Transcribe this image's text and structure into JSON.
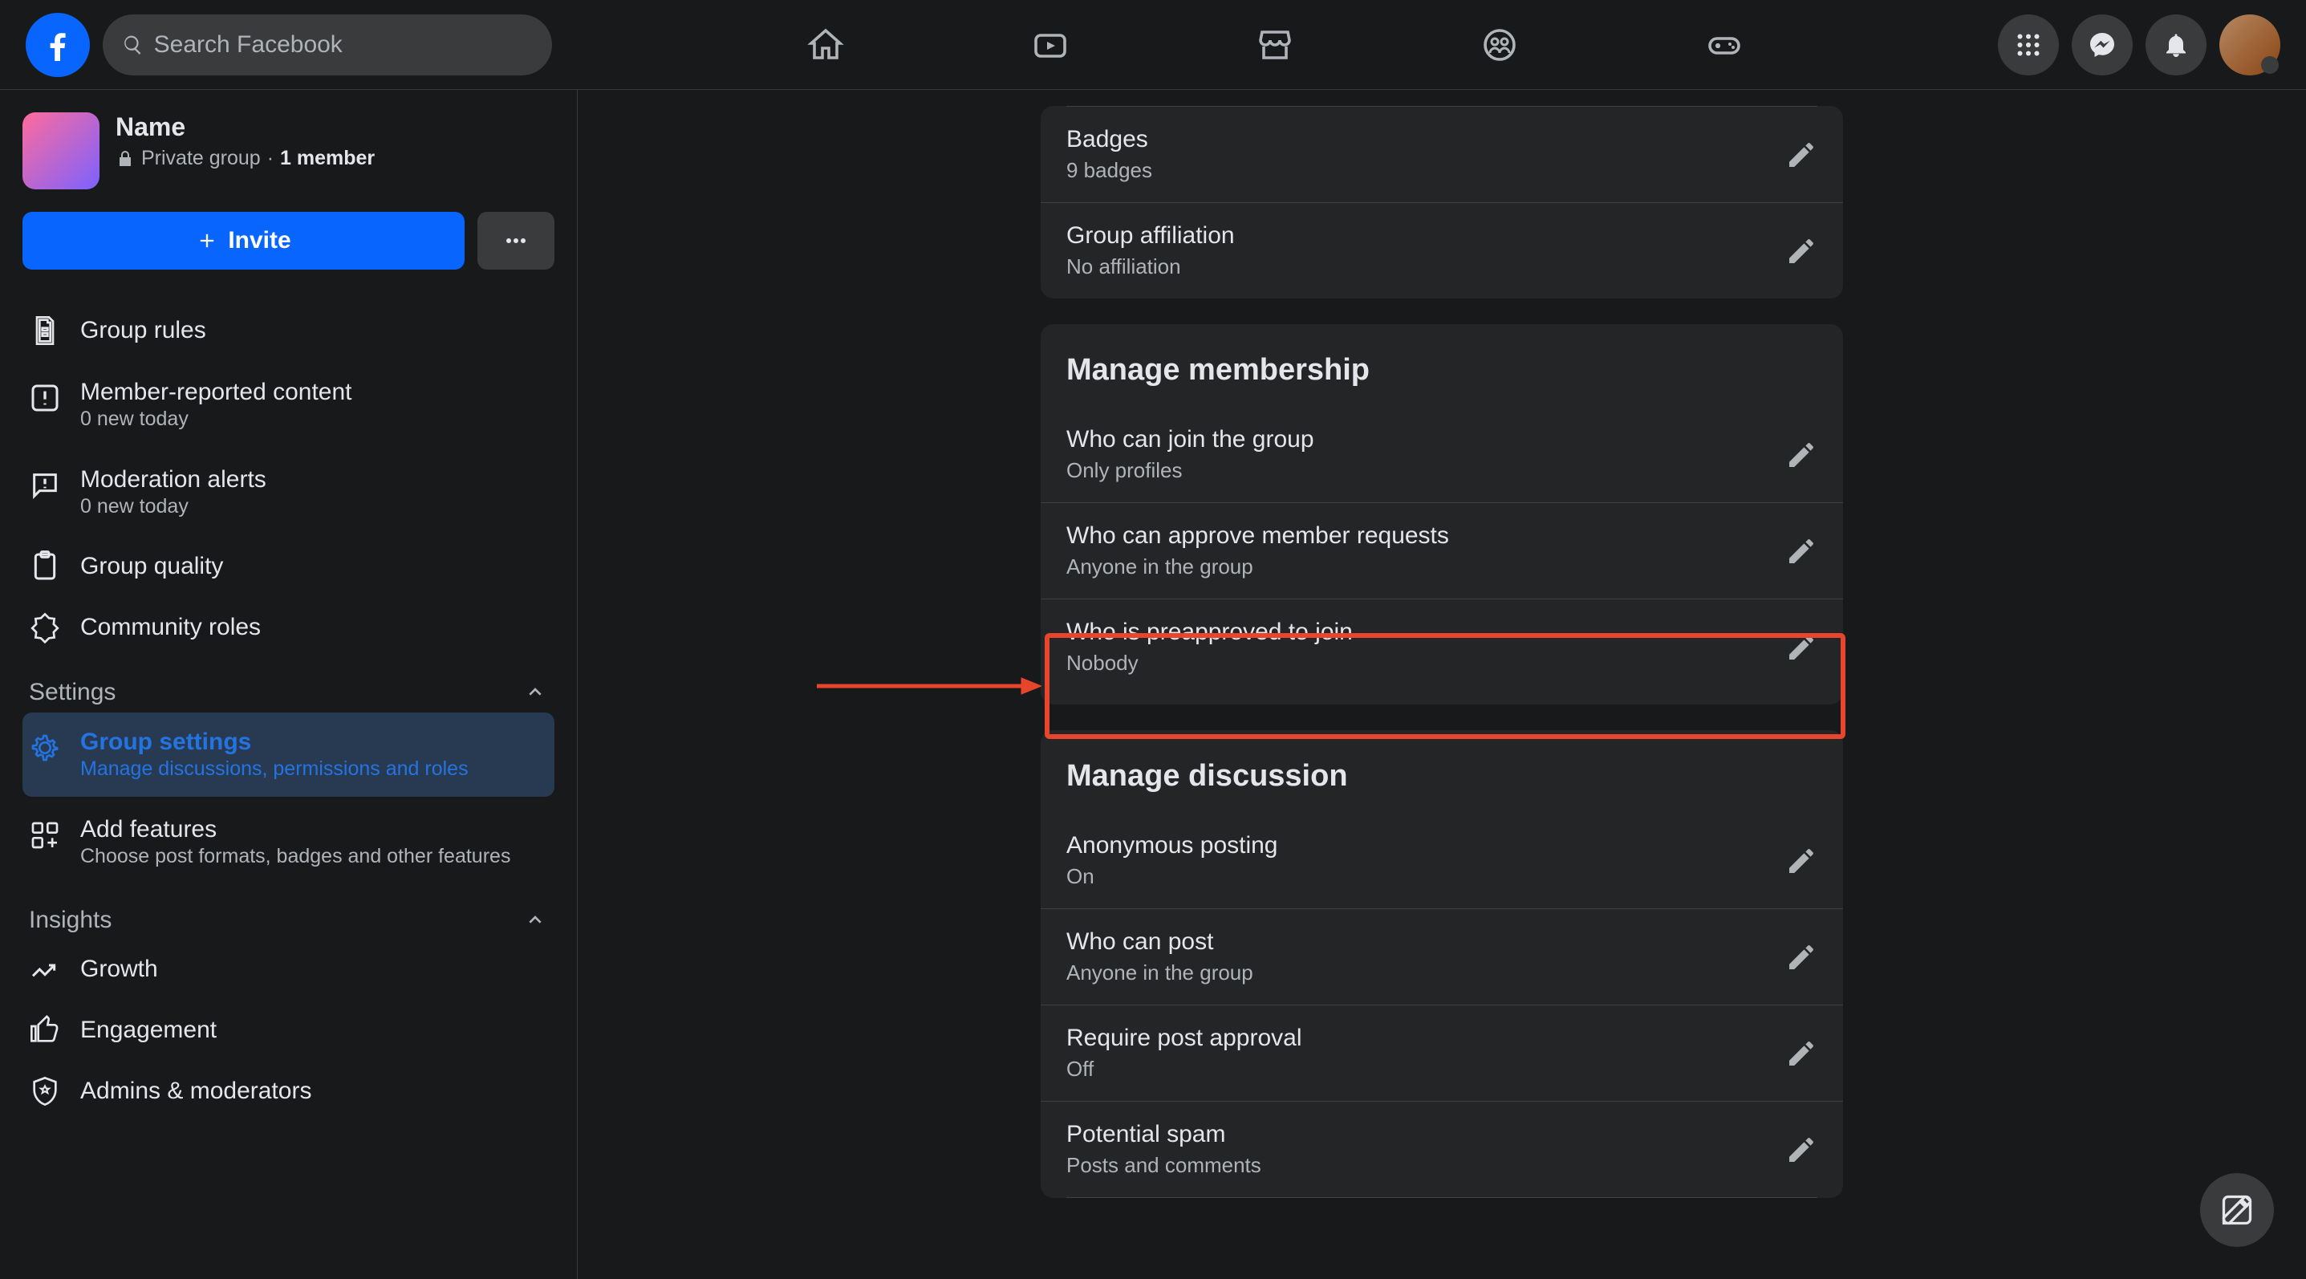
{
  "search": {
    "placeholder": "Search Facebook"
  },
  "group": {
    "name": "Name",
    "privacy": "Private group",
    "members": "1 member",
    "invite": "Invite"
  },
  "sidebar": {
    "items": [
      {
        "label": "Group rules"
      },
      {
        "label": "Member-reported content",
        "sub": "0 new today"
      },
      {
        "label": "Moderation alerts",
        "sub": "0 new today"
      },
      {
        "label": "Group quality"
      },
      {
        "label": "Community roles"
      }
    ],
    "settings_header": "Settings",
    "settings": [
      {
        "label": "Group settings",
        "sub": "Manage discussions, permissions and roles"
      },
      {
        "label": "Add features",
        "sub": "Choose post formats, badges and other features"
      }
    ],
    "insights_header": "Insights",
    "insights": [
      {
        "label": "Growth"
      },
      {
        "label": "Engagement"
      },
      {
        "label": "Admins & moderators"
      }
    ]
  },
  "top_card": {
    "rows": [
      {
        "title": "Badges",
        "value": "9 badges"
      },
      {
        "title": "Group affiliation",
        "value": "No affiliation"
      }
    ]
  },
  "membership": {
    "header": "Manage membership",
    "rows": [
      {
        "title": "Who can join the group",
        "value": "Only profiles"
      },
      {
        "title": "Who can approve member requests",
        "value": "Anyone in the group"
      },
      {
        "title": "Who is preapproved to join",
        "value": "Nobody"
      }
    ]
  },
  "discussion": {
    "header": "Manage discussion",
    "rows": [
      {
        "title": "Anonymous posting",
        "value": "On"
      },
      {
        "title": "Who can post",
        "value": "Anyone in the group"
      },
      {
        "title": "Require post approval",
        "value": "Off"
      },
      {
        "title": "Potential spam",
        "value": "Posts and comments"
      }
    ]
  }
}
